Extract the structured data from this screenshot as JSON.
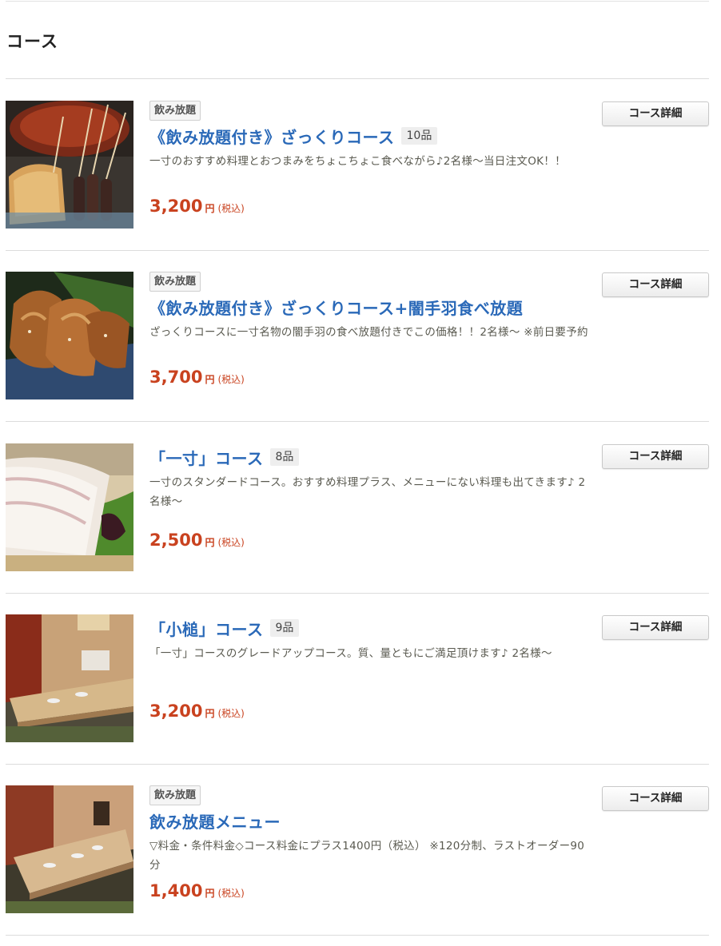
{
  "section": {
    "title": "コース"
  },
  "courses": [
    {
      "badge": "飲み放題",
      "title": "《飲み放題付き》ざっくりコース",
      "count": "10品",
      "description": "一寸のおすすめ料理とおつまみをちょこちょこ食べながら♪2名様～当日注文OK！！",
      "price": "3,200",
      "yen": "円",
      "tax": "(税込)",
      "detail_label": "コース詳細",
      "image": "kushikatsu-food-photo"
    },
    {
      "badge": "飲み放題",
      "title": "《飲み放題付き》ざっくりコース+闇手羽食べ放題",
      "count": "",
      "description": "ざっくりコースに一寸名物の闇手羽の食べ放題付きでこの価格！！2名様～ ※前日要予約",
      "price": "3,700",
      "yen": "円",
      "tax": "(税込)",
      "detail_label": "コース詳細",
      "image": "chicken-wings-photo"
    },
    {
      "badge": "",
      "title": "「一寸」コース",
      "count": "8品",
      "description": "一寸のスタンダードコース。おすすめ料理プラス、メニューにない料理も出てきます♪ 2名様～",
      "price": "2,500",
      "yen": "円",
      "tax": "(税込)",
      "detail_label": "コース詳細",
      "image": "sashimi-photo"
    },
    {
      "badge": "",
      "title": "「小槌」コース",
      "count": "9品",
      "description": "「一寸」コースのグレードアップコース。質、量ともにご満足頂けます♪ 2名様～",
      "price": "3,200",
      "yen": "円",
      "tax": "(税込)",
      "detail_label": "コース詳細",
      "image": "private-room-photo"
    },
    {
      "badge": "飲み放題",
      "title": "飲み放題メニュー",
      "count": "",
      "description": "▽料金・条件料金◇コース料金にプラス1400円（税込） ※120分制、ラストオーダー90分",
      "price": "1,400",
      "yen": "円",
      "tax": "(税込)",
      "detail_label": "コース詳細",
      "image": "table-room-photo"
    }
  ]
}
